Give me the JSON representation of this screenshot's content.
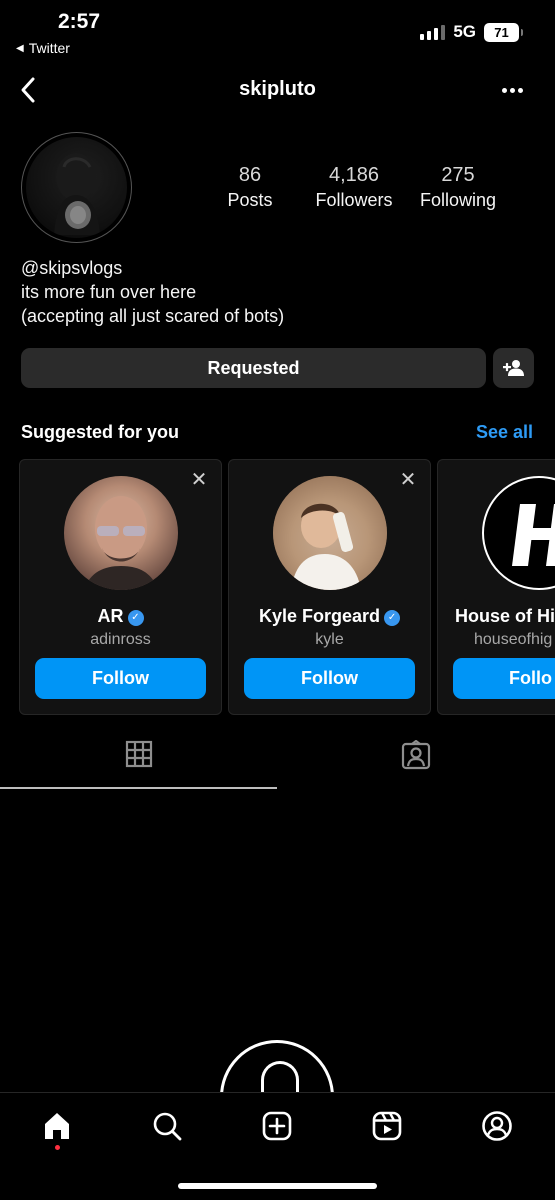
{
  "status_bar": {
    "time": "2:57",
    "back_app": "Twitter",
    "network": "5G",
    "battery": "71"
  },
  "header": {
    "username": "skipluto"
  },
  "profile": {
    "stats": {
      "posts": {
        "value": "86",
        "label": "Posts"
      },
      "followers": {
        "value": "4,186",
        "label": "Followers"
      },
      "following": {
        "value": "275",
        "label": "Following"
      }
    },
    "bio": [
      "@skipsvlogs",
      "its more fun over here",
      "(accepting all just scared of bots)"
    ]
  },
  "actions": {
    "requested_label": "Requested"
  },
  "suggested": {
    "title": "Suggested for you",
    "see_all": "See all",
    "cards": [
      {
        "name": "AR",
        "handle": "adinross",
        "follow_label": "Follow",
        "verified": true
      },
      {
        "name": "Kyle Forgeard",
        "handle": "kyle",
        "follow_label": "Follow",
        "verified": true
      },
      {
        "name": "House of Hi",
        "handle": "houseofhig",
        "follow_label": "Follo"
      }
    ]
  },
  "tabs": [
    {
      "icon": "grid-icon",
      "active": true
    },
    {
      "icon": "tagged-icon",
      "active": false
    }
  ],
  "bottom_nav": [
    {
      "icon": "home-icon",
      "active": true
    },
    {
      "icon": "search-icon"
    },
    {
      "icon": "create-icon"
    },
    {
      "icon": "reels-icon"
    },
    {
      "icon": "profile-icon"
    }
  ],
  "colors": {
    "accent": "#0095f6",
    "link": "#2e9bf5",
    "verified": "#3897f0",
    "button_bg": "#2b2b2b",
    "notification_dot": "#ff3040"
  }
}
